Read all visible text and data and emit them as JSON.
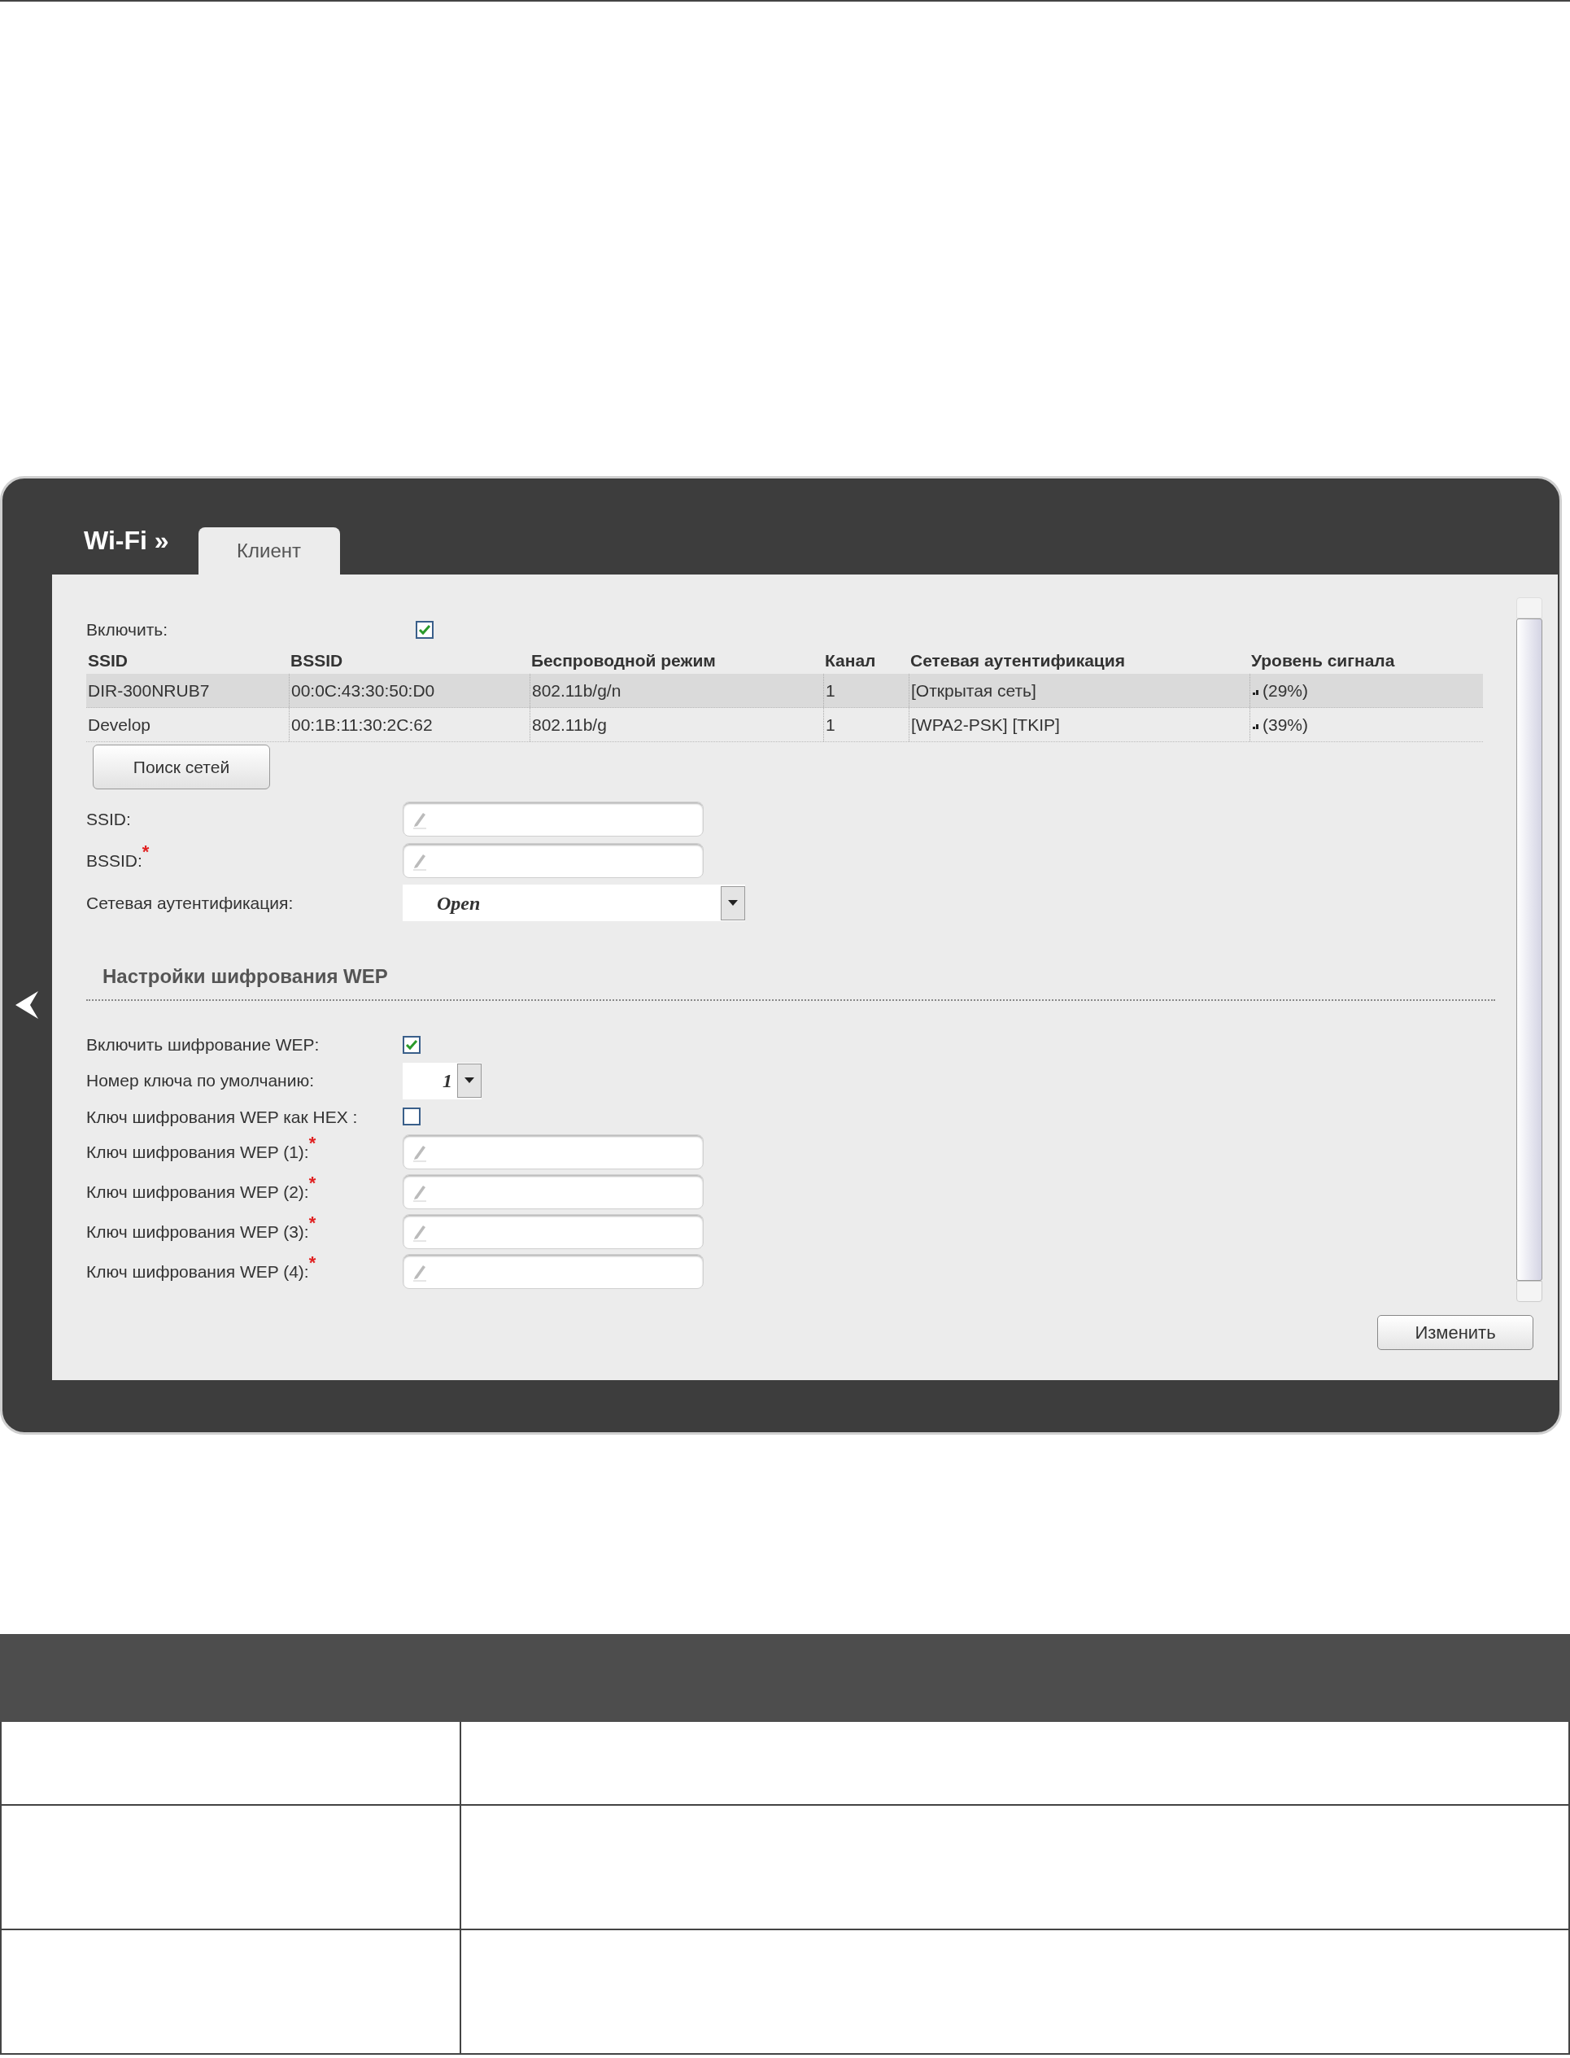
{
  "router_ui": {
    "section_title": "Wi-Fi »",
    "tabs": [
      {
        "label": "Клиент",
        "selected": true
      }
    ],
    "enable": {
      "label": "Включить:",
      "checked": true
    },
    "networks": {
      "columns": [
        "SSID",
        "BSSID",
        "Беспроводной режим",
        "Канал",
        "Сетевая аутентификация",
        "Уровень сигнала"
      ],
      "rows": [
        {
          "ssid": "DIR-300NRUB7",
          "bssid": "00:0C:43:30:50:D0",
          "mode": "802.11b/g/n",
          "channel": "1",
          "auth": "[Открытая сеть]",
          "signal": "(29%)",
          "selected": true
        },
        {
          "ssid": "Develop",
          "bssid": "00:1B:11:30:2C:62",
          "mode": "802.11b/g",
          "channel": "1",
          "auth": "[WPA2-PSK] [TKIP]",
          "signal": "(39%)",
          "selected": false
        }
      ]
    },
    "scan_button": "Поиск сетей",
    "fields": [
      {
        "kind": "text",
        "label": "SSID:"
      },
      {
        "kind": "text",
        "label": "BSSID:",
        "mark": "*"
      },
      {
        "kind": "select",
        "label": "Сетевая аутентификация:",
        "value": "Open"
      }
    ],
    "wep": {
      "title": "Настройки шифрования WEP",
      "fields": [
        {
          "kind": "checkbox",
          "label": "Включить шифрование WEP:",
          "checked": true
        },
        {
          "kind": "select",
          "label": "Номер ключа по умолчанию:",
          "value": "1"
        },
        {
          "kind": "checkbox",
          "label": "Ключ шифрования WEP как HEX :",
          "checked": false
        },
        {
          "kind": "text",
          "label": "Ключ шифрования WEP (1):",
          "mark": "*"
        },
        {
          "kind": "text",
          "label": "Ключ шифрования WEP (2):",
          "mark": "*"
        },
        {
          "kind": "text",
          "label": "Ключ шифрования WEP (3):",
          "mark": "*"
        },
        {
          "kind": "text",
          "label": "Ключ шифрования WEP (4):",
          "mark": "*"
        }
      ]
    },
    "apply_button": "Изменить"
  }
}
